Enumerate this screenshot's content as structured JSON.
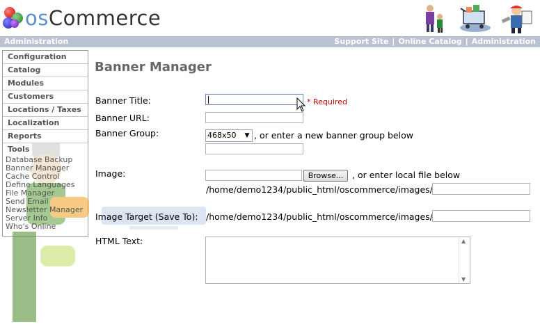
{
  "header": {
    "logo_os": "os",
    "logo_commerce": "Commerce"
  },
  "topbar": {
    "left_label": "Administration",
    "links": [
      "Support Site",
      "Online Catalog",
      "Administration"
    ],
    "separator": "|"
  },
  "sidebar": {
    "boxes": [
      "Configuration",
      "Catalog",
      "Modules",
      "Customers",
      "Locations / Taxes",
      "Localization",
      "Reports",
      "Tools"
    ],
    "tool_links": [
      "Database Backup",
      "Banner Manager",
      "Cache Control",
      "Define Languages",
      "File Manager",
      "Send Email",
      "Newsletter Manager",
      "Server Info",
      "Who's Online"
    ]
  },
  "main": {
    "title": "Banner Manager",
    "banner_title_label": "Banner Title:",
    "banner_title_value": "",
    "required_text": "* Required",
    "banner_url_label": "Banner URL:",
    "banner_url_value": "",
    "banner_group_label": "Banner Group:",
    "banner_group_selected": "468x50",
    "banner_group_hint": ", or enter a new banner group below",
    "new_group_value": "",
    "image_label": "Image:",
    "browse_label": "Browse...",
    "image_hint": ", or enter local file below",
    "image_path_prefix": "/home/demo1234/public_html/oscommerce/images/",
    "image_local_value": "",
    "image_target_label": "Image Target (Save To):",
    "image_target_prefix": "/home/demo1234/public_html/oscommerce/images/",
    "image_target_value": "",
    "html_text_label": "HTML Text:",
    "html_text_value": ""
  },
  "colors": {
    "topbar_bg": "#bbc3d3",
    "required": "#c00000",
    "title": "#666666"
  }
}
